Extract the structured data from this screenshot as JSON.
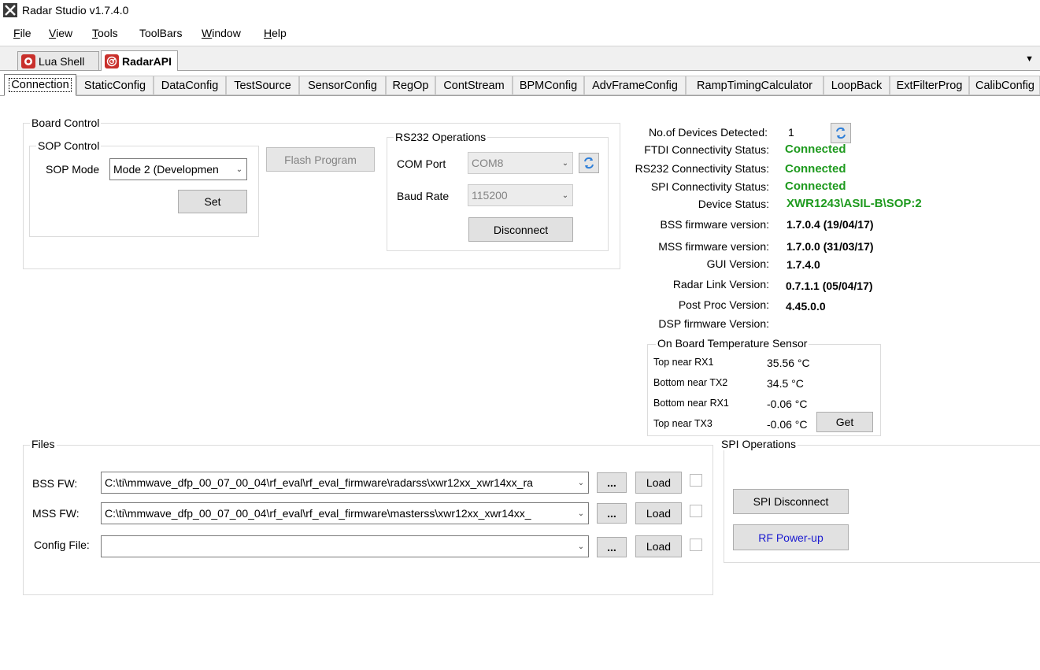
{
  "window": {
    "title": "Radar Studio v1.7.4.0"
  },
  "menu": {
    "items": [
      {
        "label": "File",
        "mnemonic": "F",
        "rest": "ile"
      },
      {
        "label": "View",
        "mnemonic": "V",
        "rest": "iew"
      },
      {
        "label": "Tools",
        "mnemonic": "T",
        "rest": "ools"
      },
      {
        "label": "ToolBars",
        "mnemonic": "",
        "rest": "ToolBars"
      },
      {
        "label": "Window",
        "mnemonic": "W",
        "rest": "indow"
      },
      {
        "label": "Help",
        "mnemonic": "H",
        "rest": "elp"
      }
    ]
  },
  "doc_tabs": [
    {
      "label": "Lua Shell",
      "active": false
    },
    {
      "label": "RadarAPI",
      "active": true
    }
  ],
  "page_tabs": [
    "Connection",
    "StaticConfig",
    "DataConfig",
    "TestSource",
    "SensorConfig",
    "RegOp",
    "ContStream",
    "BPMConfig",
    "AdvFrameConfig",
    "RampTimingCalculator",
    "LoopBack",
    "ExtFilterProg",
    "CalibConfig"
  ],
  "board_control": {
    "title": "Board Control",
    "sop": {
      "title": "SOP Control",
      "mode_label": "SOP Mode",
      "mode_value": "Mode 2 (Developmen",
      "set_label": "Set"
    },
    "flash_label": "Flash Program"
  },
  "rs232": {
    "title": "RS232 Operations",
    "com_label": "COM Port",
    "com_value": "COM8",
    "baud_label": "Baud Rate",
    "baud_value": "115200",
    "disconnect_label": "Disconnect"
  },
  "status": {
    "devices_label": "No.of Devices Detected:",
    "devices_value": "1",
    "ftdi_label": "FTDI Connectivity Status:",
    "ftdi_value": "Connected",
    "rs232_label": "RS232 Connectivity Status:",
    "rs232_value": "Connected",
    "spi_label": "SPI Connectivity Status:",
    "spi_value": "Connected",
    "device_label": "Device Status:",
    "device_value": "XWR1243\\ASIL-B\\SOP:2",
    "bss_label": "BSS firmware version:",
    "bss_value": "1.7.0.4 (19/04/17)",
    "mss_label": "MSS firmware version:",
    "mss_value": "1.7.0.0 (31/03/17)",
    "gui_label": "GUI Version:",
    "gui_value": "1.7.4.0",
    "radarlink_label": "Radar Link Version:",
    "radarlink_value": "0.7.1.1 (05/04/17)",
    "postproc_label": "Post Proc Version:",
    "postproc_value": "4.45.0.0",
    "dsp_label": "DSP firmware Version:",
    "dsp_value": ""
  },
  "temperature": {
    "title": "On Board Temperature Sensor",
    "rows": [
      {
        "label": "Top near RX1",
        "value": "35.56 °C"
      },
      {
        "label": "Bottom near TX2",
        "value": "34.5 °C"
      },
      {
        "label": "Bottom near RX1",
        "value": "-0.06 °C"
      },
      {
        "label": "Top near TX3",
        "value": "-0.06 °C"
      }
    ],
    "get_label": "Get"
  },
  "files": {
    "title": "Files",
    "bss_label": "BSS FW:",
    "bss_value": "C:\\ti\\mmwave_dfp_00_07_00_04\\rf_eval\\rf_eval_firmware\\radarss\\xwr12xx_xwr14xx_ra",
    "mss_label": "MSS FW:",
    "mss_value": "C:\\ti\\mmwave_dfp_00_07_00_04\\rf_eval\\rf_eval_firmware\\masterss\\xwr12xx_xwr14xx_",
    "config_label": "Config File:",
    "config_value": "",
    "browse_label": "...",
    "load_label": "Load"
  },
  "spi": {
    "title": "SPI Operations",
    "disconnect_label": "SPI Disconnect",
    "powerup_label": "RF Power-up"
  },
  "colors": {
    "connected": "#1e9a1e",
    "rf_powerup_text": "#1a1ad0",
    "refresh_icon": "#2f7fd8"
  }
}
